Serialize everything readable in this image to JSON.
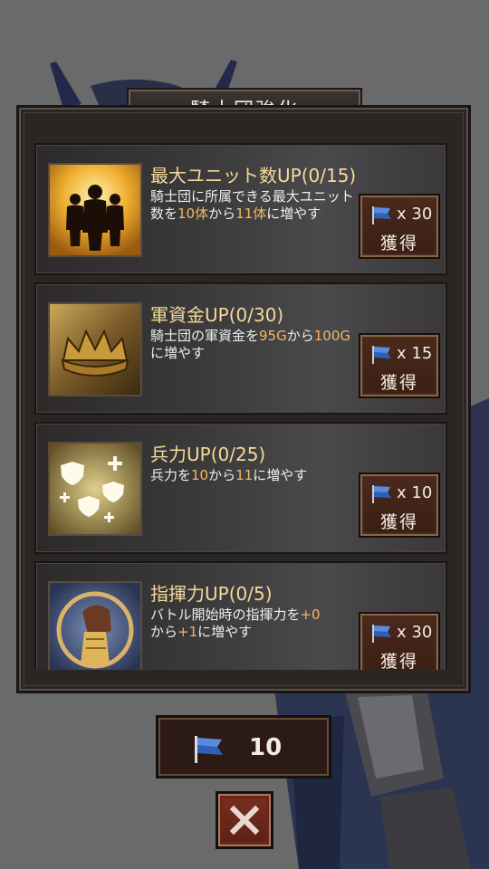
{
  "header": {
    "title": "騎士団強化"
  },
  "upgrades": [
    {
      "title": "最大ユニット数UP(0/15)",
      "desc_a": "騎士団に所属できる最大ユニット数を",
      "val_from": "10体",
      "desc_b": "から",
      "val_to": "11体",
      "desc_c": "に増やす",
      "cost": "x 30",
      "button_label": "獲得",
      "icon": "silhouettes-icon"
    },
    {
      "title": "軍資金UP(0/30)",
      "desc_a": "騎士団の軍資金を",
      "val_from": "95G",
      "desc_b": "から",
      "val_to": "100G",
      "desc_c": "に増やす",
      "cost": "x 15",
      "button_label": "獲得",
      "icon": "crown-icon"
    },
    {
      "title": "兵力UP(0/25)",
      "desc_a": "兵力を",
      "val_from": "10",
      "desc_b": "から",
      "val_to": "11",
      "desc_c": "に増やす",
      "cost": "x 10",
      "button_label": "獲得",
      "icon": "shields-icon"
    },
    {
      "title": "指揮力UP(0/5)",
      "desc_a": "バトル開始時の指揮力を",
      "val_from": "+0",
      "desc_b": "から",
      "val_to": "+1",
      "desc_c": "に増やす",
      "cost": "x 30",
      "button_label": "獲得",
      "icon": "fist-icon"
    }
  ],
  "currency": {
    "amount": "10",
    "icon": "blue-flag-icon"
  },
  "close": {
    "icon": "close-icon"
  },
  "colors": {
    "highlight": "#f3b762",
    "title": "#f6d99a",
    "button": "#3a1f14",
    "close": "#6a261a"
  }
}
